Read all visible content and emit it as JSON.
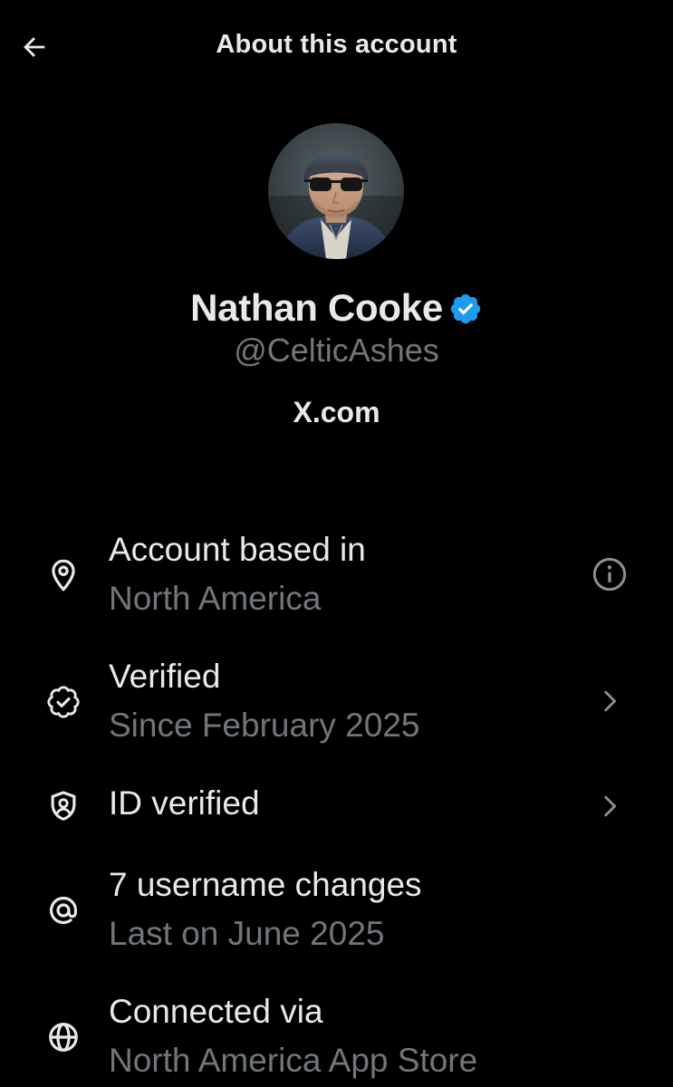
{
  "header": {
    "title": "About this account",
    "back_icon": "arrow-left-icon"
  },
  "profile": {
    "name": "Nathan Cooke",
    "handle": "@CelticAshes",
    "site": "X.com",
    "verified_color": "#1d9bf0"
  },
  "rows": [
    {
      "icon": "location-pin-icon",
      "title": "Account based in",
      "subtitle": "North America",
      "trailing": "info-icon"
    },
    {
      "icon": "verified-badge-outline-icon",
      "title": "Verified",
      "subtitle": "Since February 2025",
      "trailing": "chevron-right-icon"
    },
    {
      "icon": "id-shield-icon",
      "title": "ID verified",
      "subtitle": "",
      "trailing": "chevron-right-icon"
    },
    {
      "icon": "at-sign-icon",
      "title": "7 username changes",
      "subtitle": "Last on June 2025",
      "trailing": ""
    },
    {
      "icon": "globe-icon",
      "title": "Connected via",
      "subtitle": "North America App Store",
      "trailing": ""
    }
  ],
  "colors": {
    "background": "#000000",
    "primary_text": "#e7e9ea",
    "secondary_text": "#71767b",
    "accent": "#1d9bf0"
  }
}
